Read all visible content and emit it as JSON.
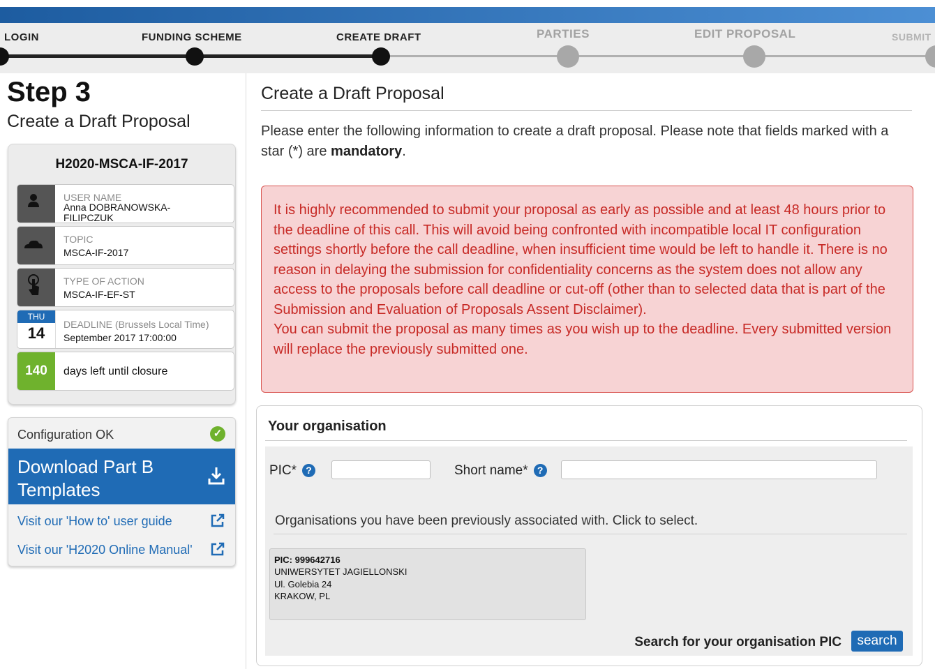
{
  "progress": {
    "steps": [
      {
        "label": "LOGIN",
        "state": "done"
      },
      {
        "label": "FUNDING SCHEME",
        "state": "done"
      },
      {
        "label": "CREATE DRAFT",
        "state": "current"
      },
      {
        "label": "PARTIES",
        "state": "todo"
      },
      {
        "label": "EDIT PROPOSAL",
        "state": "todo"
      },
      {
        "label": "SUBMIT",
        "state": "todo"
      }
    ]
  },
  "sidebar": {
    "step_title": "Step 3",
    "step_subtitle": "Create a Draft Proposal",
    "call_id": "H2020-MSCA-IF-2017",
    "user": {
      "label": "USER NAME",
      "value": "Anna DOBRANOWSKA-FILIPCZUK"
    },
    "topic": {
      "label": "TOPIC",
      "value": "MSCA-IF-2017"
    },
    "action": {
      "label": "TYPE OF ACTION",
      "value": "MSCA-IF-EF-ST"
    },
    "deadline": {
      "day_name": "THU",
      "day_num": "14",
      "label": "DEADLINE (Brussels Local Time)",
      "value": "September 2017 17:00:00"
    },
    "days_left": {
      "count": "140",
      "label": "days left until closure"
    },
    "config_status": "Configuration OK",
    "download_label": "Download Part B Templates",
    "link_guide": "Visit our 'How to' user guide",
    "link_manual": "Visit our 'H2020 Online Manual'"
  },
  "main": {
    "title": "Create a Draft Proposal",
    "intro_text": "Please enter the following information to create a draft proposal. Please note that fields marked with a star (*) are ",
    "intro_bold": "mandatory",
    "intro_end": ".",
    "alert_p1": "It is highly recommended to submit your proposal as early as possible and at least 48 hours prior to the deadline of this call. This will avoid being confronted with incompatible local IT configuration settings shortly before the call deadline, when insufficient time would be left to handle it. There is no reason in delaying the submission for confidentiality concerns as the system does not allow any access to the proposals before call deadline or cut-off (other than to selected data that is part of the Submission and Evaluation of Proposals Assent Disclaimer).",
    "alert_p2": "You can submit the proposal as many times as you wish up to the deadline. Every submitted version will replace the previously submitted one."
  },
  "organisation": {
    "title": "Your organisation",
    "pic_label": "PIC*",
    "pic_value": "",
    "short_name_label": "Short name*",
    "short_name_value": "",
    "help_glyph": "?",
    "assoc_text": "Organisations you have been previously associated with. Click to select.",
    "card": {
      "pic": "PIC: 999642716",
      "name": "UNIWERSYTET JAGIELLONSKI",
      "street": "Ul. Golebia 24",
      "city": "KRAKOW, PL"
    },
    "search_label": "Search for your organisation PIC",
    "search_button": "search"
  },
  "colors": {
    "brand_blue": "#1f6bb5",
    "alert_red": "#c72a26",
    "ok_green": "#6fb22d"
  },
  "icons": [
    "user-icon",
    "cloud-icon",
    "hand-pointer-icon",
    "calendar-icon",
    "check-icon",
    "download-icon",
    "external-link-icon",
    "help-icon"
  ]
}
